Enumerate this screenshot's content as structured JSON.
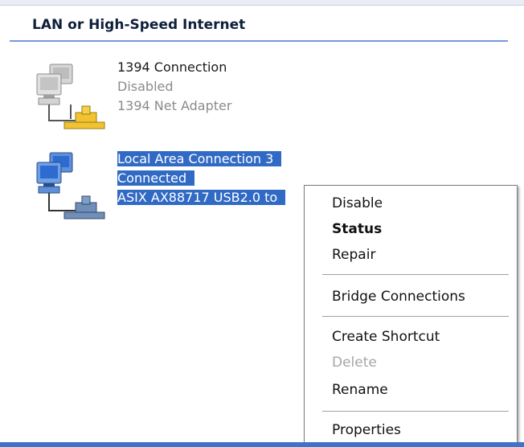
{
  "section": {
    "title": "LAN or High-Speed Internet"
  },
  "connections": [
    {
      "name": "1394 Connection",
      "status": "Disabled",
      "adapter": "1394 Net Adapter",
      "icon": "disabled-network-connection-icon",
      "selected": false
    },
    {
      "name": "Local Area Connection 3",
      "status": "Connected",
      "adapter": "ASIX AX88717 USB2.0 to",
      "icon": "network-connection-icon",
      "selected": true
    }
  ],
  "context_menu": {
    "items": [
      {
        "label": "Disable",
        "style": "normal"
      },
      {
        "label": "Status",
        "style": "bold"
      },
      {
        "label": "Repair",
        "style": "normal"
      },
      {
        "label": "Bridge Connections",
        "style": "normal"
      },
      {
        "label": "Create Shortcut",
        "style": "normal"
      },
      {
        "label": "Delete",
        "style": "disabled"
      },
      {
        "label": "Rename",
        "style": "normal"
      },
      {
        "label": "Properties",
        "style": "normal"
      }
    ]
  },
  "colors": {
    "selection": "#316ac5",
    "header_rule": "#7a96df"
  }
}
